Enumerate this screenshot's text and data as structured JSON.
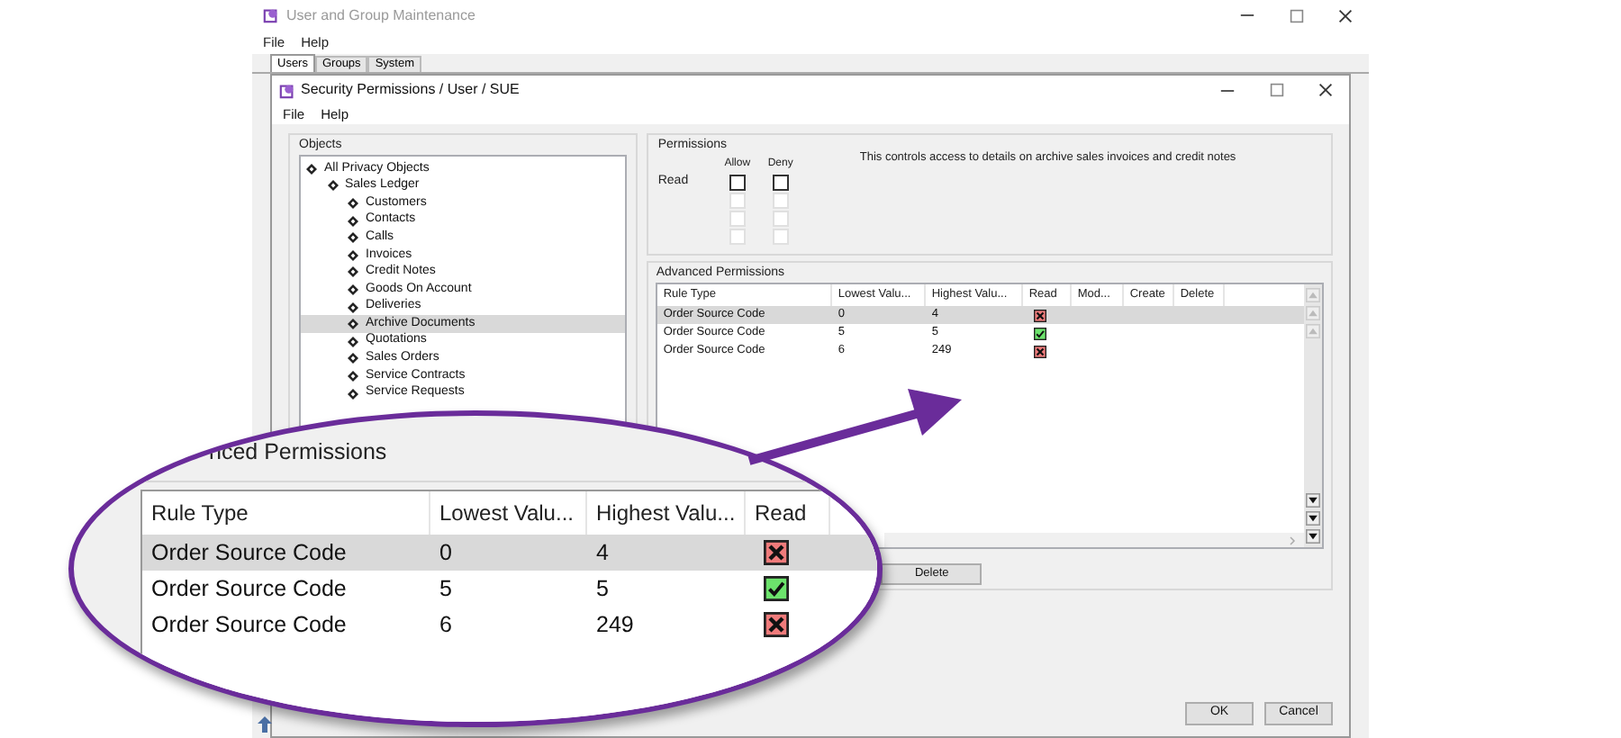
{
  "app_window": {
    "title": "User and Group Maintenance",
    "menu": [
      "File",
      "Help"
    ],
    "tabs": [
      {
        "label": "Users",
        "selected": true
      },
      {
        "label": "Groups",
        "selected": false
      },
      {
        "label": "System",
        "selected": false
      }
    ]
  },
  "dialog": {
    "title": "Security Permissions / User / SUE",
    "menu": [
      "File",
      "Help"
    ],
    "objects": {
      "title": "Objects",
      "tree": [
        {
          "label": "All Privacy Objects",
          "selected": false,
          "children": [
            {
              "label": "Sales Ledger",
              "selected": false,
              "children": [
                {
                  "label": "Customers",
                  "selected": false
                },
                {
                  "label": "Contacts",
                  "selected": false
                },
                {
                  "label": "Calls",
                  "selected": false
                },
                {
                  "label": "Invoices",
                  "selected": false
                },
                {
                  "label": "Credit Notes",
                  "selected": false
                },
                {
                  "label": "Goods On Account",
                  "selected": false
                },
                {
                  "label": "Deliveries",
                  "selected": false
                },
                {
                  "label": "Archive Documents",
                  "selected": true
                },
                {
                  "label": "Quotations",
                  "selected": false
                },
                {
                  "label": "Sales Orders",
                  "selected": false
                },
                {
                  "label": "Service Contracts",
                  "selected": false
                },
                {
                  "label": "Service Requests",
                  "selected": false
                }
              ]
            }
          ]
        }
      ]
    },
    "permissions": {
      "title": "Permissions",
      "columns": [
        "Allow",
        "Deny"
      ],
      "description": "This controls access to details on archive sales invoices and credit notes",
      "rows": [
        {
          "label": "Read",
          "allow": false,
          "deny": false,
          "disabled": false
        },
        {
          "allow": false,
          "deny": false,
          "disabled": true
        },
        {
          "allow": false,
          "deny": false,
          "disabled": true
        },
        {
          "allow": false,
          "deny": false,
          "disabled": true
        }
      ]
    },
    "advanced_permissions": {
      "title": "Advanced Permissions",
      "columns": [
        "Rule Type",
        "Lowest Valu...",
        "Highest Valu...",
        "Read",
        "Mod...",
        "Create",
        "Delete"
      ],
      "rows": [
        {
          "rule_type": "Order Source Code",
          "lowest": "0",
          "highest": "4",
          "read": false,
          "selected": true
        },
        {
          "rule_type": "Order Source Code",
          "lowest": "5",
          "highest": "5",
          "read": true,
          "selected": false
        },
        {
          "rule_type": "Order Source Code",
          "lowest": "6",
          "highest": "249",
          "read": false,
          "selected": false
        }
      ],
      "delete_button": "Delete"
    },
    "buttons": [
      "OK",
      "Cancel"
    ]
  },
  "callout": {
    "title": "nced Permissions",
    "columns": [
      "Rule Type",
      "Lowest Valu...",
      "Highest Valu...",
      "Read"
    ],
    "rows": [
      {
        "rule_type": "Order Source Code",
        "lowest": "0",
        "highest": "4",
        "read": false,
        "selected": true
      },
      {
        "rule_type": "Order Source Code",
        "lowest": "5",
        "highest": "5",
        "read": true,
        "selected": false
      },
      {
        "rule_type": "Order Source Code",
        "lowest": "6",
        "highest": "249",
        "read": false,
        "selected": false
      }
    ]
  }
}
